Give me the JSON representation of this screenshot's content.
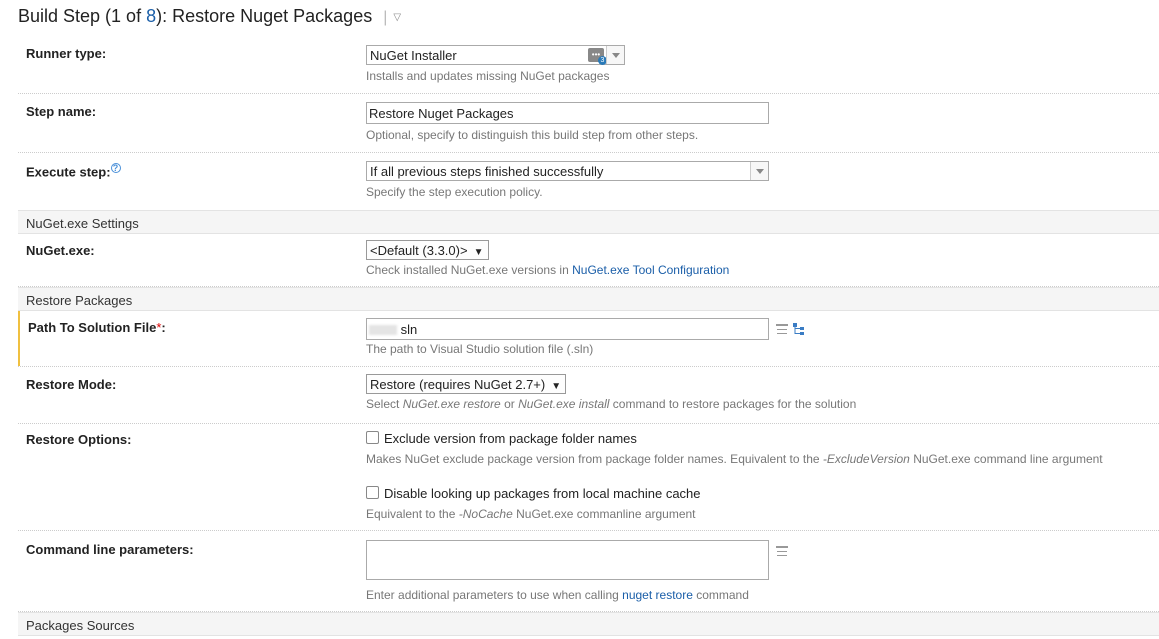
{
  "header": {
    "title_prefix": "Build Step (1 of ",
    "step_total": "8",
    "title_suffix": "): Restore Nuget Packages"
  },
  "runner_type": {
    "label": "Runner type:",
    "value": "NuGet Installer",
    "badge": "3",
    "help": "Installs and updates missing NuGet packages"
  },
  "step_name": {
    "label": "Step name:",
    "value": "Restore Nuget Packages",
    "help": "Optional, specify to distinguish this build step from other steps."
  },
  "execute_step": {
    "label": "Execute step:",
    "value": "If all previous steps finished successfully",
    "help": "Specify the step execution policy."
  },
  "section_nuget_settings": "NuGet.exe Settings",
  "nuget_exe": {
    "label": "NuGet.exe:",
    "value": "<Default (3.3.0)>",
    "help_prefix": "Check installed NuGet.exe versions in ",
    "help_link": "NuGet.exe Tool Configuration"
  },
  "section_restore_packages": "Restore Packages",
  "solution_path": {
    "label": "Path To Solution File",
    "required_mark": "*",
    "label_colon": ":",
    "value": "sln",
    "help": "The path to Visual Studio solution file (.sln)"
  },
  "restore_mode": {
    "label": "Restore Mode:",
    "value": "Restore (requires NuGet 2.7+)",
    "help_1": "Select ",
    "help_em1": "NuGet.exe restore",
    "help_2": " or ",
    "help_em2": "NuGet.exe install",
    "help_3": " command to restore packages for the solution"
  },
  "restore_options": {
    "label": "Restore Options:",
    "option1_label": "Exclude version from package folder names",
    "option1_help_1": "Makes NuGet exclude package version from package folder names. Equivalent to the ",
    "option1_help_em": "-ExcludeVersion",
    "option1_help_2": " NuGet.exe command line argument",
    "option2_label": "Disable looking up packages from local machine cache",
    "option2_help_1": "Equivalent to the ",
    "option2_help_em": "-NoCache",
    "option2_help_2": " NuGet.exe commanline argument"
  },
  "command_line": {
    "label": "Command line parameters:",
    "value": "",
    "help_1": "Enter additional parameters to use when calling ",
    "help_link": "nuget restore",
    "help_2": " command"
  },
  "section_packages_sources": "Packages Sources"
}
